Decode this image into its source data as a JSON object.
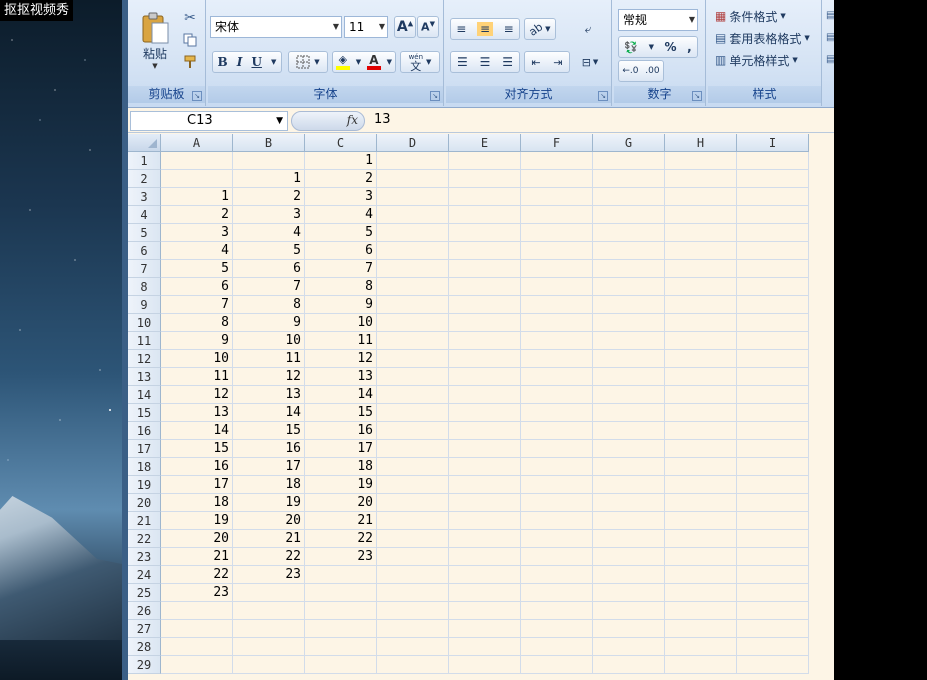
{
  "watermark": "抠抠视频秀",
  "ribbon": {
    "clipboard": {
      "paste_label": "粘贴",
      "group_label": "剪贴板"
    },
    "font": {
      "font_name": "宋体",
      "font_size": "11",
      "group_label": "字体",
      "bold": "B",
      "italic": "I",
      "underline": "U",
      "font_color_letter": "A",
      "wen": "wén"
    },
    "alignment": {
      "group_label": "对齐方式"
    },
    "number": {
      "format": "常规",
      "percent": "%",
      "comma": ",",
      "group_label": "数字"
    },
    "styles": {
      "conditional_format": "条件格式",
      "table_format": "套用表格格式",
      "cell_style": "单元格样式",
      "group_label": "样式"
    }
  },
  "formula_bar": {
    "name_box": "C13",
    "fx": "fx",
    "value": "13"
  },
  "sheet": {
    "columns": [
      "A",
      "B",
      "C",
      "D",
      "E",
      "F",
      "G",
      "H",
      "I"
    ],
    "rows": [
      "1",
      "2",
      "3",
      "4",
      "5",
      "6",
      "7",
      "8",
      "9",
      "10",
      "11",
      "12",
      "13",
      "14",
      "15",
      "16",
      "17",
      "18",
      "19",
      "20",
      "21",
      "22",
      "23",
      "24",
      "25",
      "26",
      "27",
      "28",
      "29"
    ],
    "cells": [
      [
        "",
        "",
        "1"
      ],
      [
        "",
        "1",
        "2"
      ],
      [
        "1",
        "2",
        "3"
      ],
      [
        "2",
        "3",
        "4"
      ],
      [
        "3",
        "4",
        "5"
      ],
      [
        "4",
        "5",
        "6"
      ],
      [
        "5",
        "6",
        "7"
      ],
      [
        "6",
        "7",
        "8"
      ],
      [
        "7",
        "8",
        "9"
      ],
      [
        "8",
        "9",
        "10"
      ],
      [
        "9",
        "10",
        "11"
      ],
      [
        "10",
        "11",
        "12"
      ],
      [
        "11",
        "12",
        "13"
      ],
      [
        "12",
        "13",
        "14"
      ],
      [
        "13",
        "14",
        "15"
      ],
      [
        "14",
        "15",
        "16"
      ],
      [
        "15",
        "16",
        "17"
      ],
      [
        "16",
        "17",
        "18"
      ],
      [
        "17",
        "18",
        "19"
      ],
      [
        "18",
        "19",
        "20"
      ],
      [
        "19",
        "20",
        "21"
      ],
      [
        "20",
        "21",
        "22"
      ],
      [
        "21",
        "22",
        "23"
      ],
      [
        "22",
        "23",
        ""
      ],
      [
        "23",
        "",
        ""
      ],
      [
        "",
        "",
        ""
      ],
      [
        "",
        "",
        ""
      ],
      [
        "",
        "",
        ""
      ],
      [
        "",
        "",
        ""
      ]
    ]
  }
}
